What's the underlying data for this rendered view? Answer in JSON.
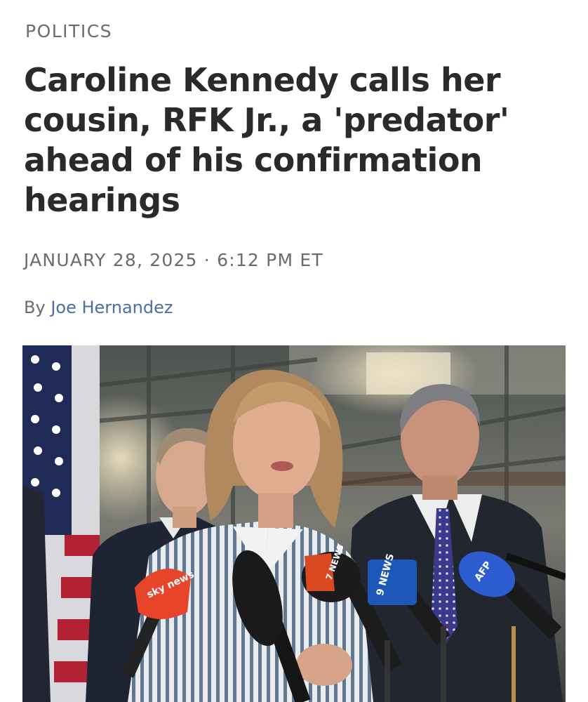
{
  "article": {
    "section": "POLITICS",
    "headline": "Caroline Kennedy calls her cousin, RFK Jr., a 'predator' ahead of his confirmation hearings",
    "date": "JANUARY 28, 2025 · 6:12 PM ET",
    "byline_prefix": "By",
    "author": "Joe Hernandez"
  },
  "photo": {
    "mic_flags": {
      "sky": "sky news",
      "seven": "7 NEWS",
      "nine": "9 NEWS",
      "afp": "AFP"
    }
  },
  "colors": {
    "headline": "#2a2a2a",
    "meta_gray": "#6b6b6b",
    "author_link": "#4a6fa5"
  }
}
